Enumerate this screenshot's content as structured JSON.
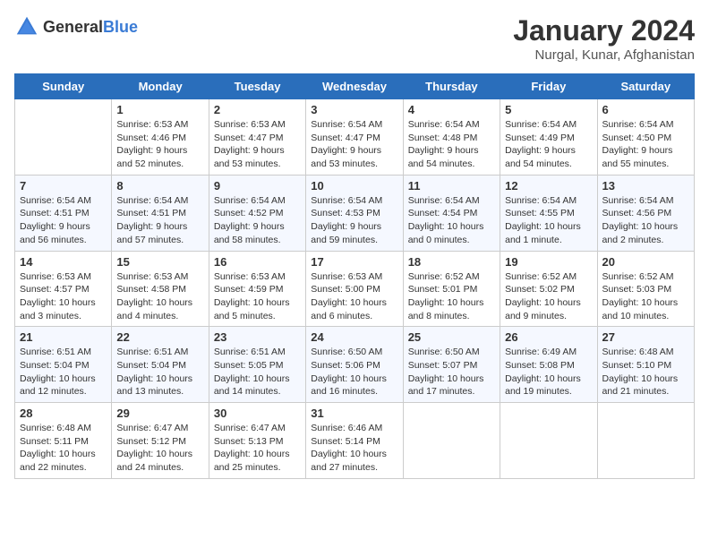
{
  "header": {
    "logo_general": "General",
    "logo_blue": "Blue",
    "title": "January 2024",
    "location": "Nurgal, Kunar, Afghanistan"
  },
  "days_of_week": [
    "Sunday",
    "Monday",
    "Tuesday",
    "Wednesday",
    "Thursday",
    "Friday",
    "Saturday"
  ],
  "weeks": [
    [
      {
        "day": "",
        "info": ""
      },
      {
        "day": "1",
        "info": "Sunrise: 6:53 AM\nSunset: 4:46 PM\nDaylight: 9 hours\nand 52 minutes."
      },
      {
        "day": "2",
        "info": "Sunrise: 6:53 AM\nSunset: 4:47 PM\nDaylight: 9 hours\nand 53 minutes."
      },
      {
        "day": "3",
        "info": "Sunrise: 6:54 AM\nSunset: 4:47 PM\nDaylight: 9 hours\nand 53 minutes."
      },
      {
        "day": "4",
        "info": "Sunrise: 6:54 AM\nSunset: 4:48 PM\nDaylight: 9 hours\nand 54 minutes."
      },
      {
        "day": "5",
        "info": "Sunrise: 6:54 AM\nSunset: 4:49 PM\nDaylight: 9 hours\nand 54 minutes."
      },
      {
        "day": "6",
        "info": "Sunrise: 6:54 AM\nSunset: 4:50 PM\nDaylight: 9 hours\nand 55 minutes."
      }
    ],
    [
      {
        "day": "7",
        "info": "Sunrise: 6:54 AM\nSunset: 4:51 PM\nDaylight: 9 hours\nand 56 minutes."
      },
      {
        "day": "8",
        "info": "Sunrise: 6:54 AM\nSunset: 4:51 PM\nDaylight: 9 hours\nand 57 minutes."
      },
      {
        "day": "9",
        "info": "Sunrise: 6:54 AM\nSunset: 4:52 PM\nDaylight: 9 hours\nand 58 minutes."
      },
      {
        "day": "10",
        "info": "Sunrise: 6:54 AM\nSunset: 4:53 PM\nDaylight: 9 hours\nand 59 minutes."
      },
      {
        "day": "11",
        "info": "Sunrise: 6:54 AM\nSunset: 4:54 PM\nDaylight: 10 hours\nand 0 minutes."
      },
      {
        "day": "12",
        "info": "Sunrise: 6:54 AM\nSunset: 4:55 PM\nDaylight: 10 hours\nand 1 minute."
      },
      {
        "day": "13",
        "info": "Sunrise: 6:54 AM\nSunset: 4:56 PM\nDaylight: 10 hours\nand 2 minutes."
      }
    ],
    [
      {
        "day": "14",
        "info": "Sunrise: 6:53 AM\nSunset: 4:57 PM\nDaylight: 10 hours\nand 3 minutes."
      },
      {
        "day": "15",
        "info": "Sunrise: 6:53 AM\nSunset: 4:58 PM\nDaylight: 10 hours\nand 4 minutes."
      },
      {
        "day": "16",
        "info": "Sunrise: 6:53 AM\nSunset: 4:59 PM\nDaylight: 10 hours\nand 5 minutes."
      },
      {
        "day": "17",
        "info": "Sunrise: 6:53 AM\nSunset: 5:00 PM\nDaylight: 10 hours\nand 6 minutes."
      },
      {
        "day": "18",
        "info": "Sunrise: 6:52 AM\nSunset: 5:01 PM\nDaylight: 10 hours\nand 8 minutes."
      },
      {
        "day": "19",
        "info": "Sunrise: 6:52 AM\nSunset: 5:02 PM\nDaylight: 10 hours\nand 9 minutes."
      },
      {
        "day": "20",
        "info": "Sunrise: 6:52 AM\nSunset: 5:03 PM\nDaylight: 10 hours\nand 10 minutes."
      }
    ],
    [
      {
        "day": "21",
        "info": "Sunrise: 6:51 AM\nSunset: 5:04 PM\nDaylight: 10 hours\nand 12 minutes."
      },
      {
        "day": "22",
        "info": "Sunrise: 6:51 AM\nSunset: 5:04 PM\nDaylight: 10 hours\nand 13 minutes."
      },
      {
        "day": "23",
        "info": "Sunrise: 6:51 AM\nSunset: 5:05 PM\nDaylight: 10 hours\nand 14 minutes."
      },
      {
        "day": "24",
        "info": "Sunrise: 6:50 AM\nSunset: 5:06 PM\nDaylight: 10 hours\nand 16 minutes."
      },
      {
        "day": "25",
        "info": "Sunrise: 6:50 AM\nSunset: 5:07 PM\nDaylight: 10 hours\nand 17 minutes."
      },
      {
        "day": "26",
        "info": "Sunrise: 6:49 AM\nSunset: 5:08 PM\nDaylight: 10 hours\nand 19 minutes."
      },
      {
        "day": "27",
        "info": "Sunrise: 6:48 AM\nSunset: 5:10 PM\nDaylight: 10 hours\nand 21 minutes."
      }
    ],
    [
      {
        "day": "28",
        "info": "Sunrise: 6:48 AM\nSunset: 5:11 PM\nDaylight: 10 hours\nand 22 minutes."
      },
      {
        "day": "29",
        "info": "Sunrise: 6:47 AM\nSunset: 5:12 PM\nDaylight: 10 hours\nand 24 minutes."
      },
      {
        "day": "30",
        "info": "Sunrise: 6:47 AM\nSunset: 5:13 PM\nDaylight: 10 hours\nand 25 minutes."
      },
      {
        "day": "31",
        "info": "Sunrise: 6:46 AM\nSunset: 5:14 PM\nDaylight: 10 hours\nand 27 minutes."
      },
      {
        "day": "",
        "info": ""
      },
      {
        "day": "",
        "info": ""
      },
      {
        "day": "",
        "info": ""
      }
    ]
  ]
}
